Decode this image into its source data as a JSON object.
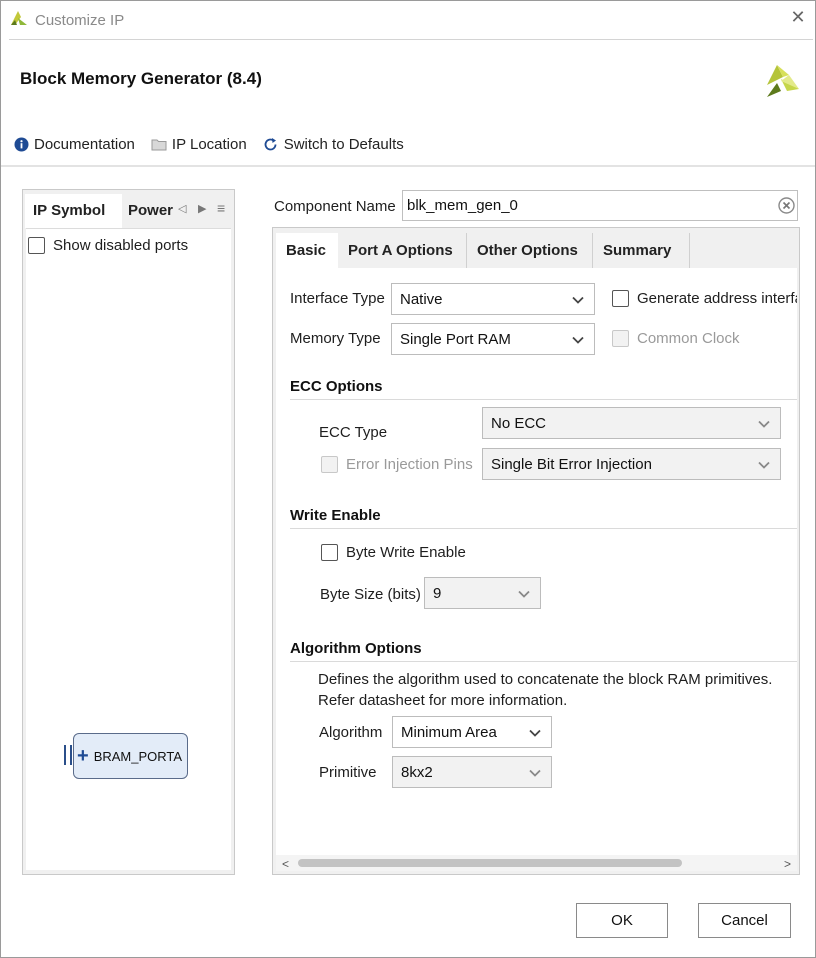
{
  "window": {
    "title": "Customize IP"
  },
  "header": {
    "title": "Block Memory Generator (8.4)"
  },
  "toolbar": {
    "documentation": "Documentation",
    "ip_location": "IP Location",
    "switch_defaults": "Switch to Defaults"
  },
  "left_panel": {
    "tabs": [
      "IP Symbol",
      "Power"
    ],
    "show_disabled_ports": "Show disabled ports",
    "symbol_port": "BRAM_PORTA"
  },
  "component": {
    "label": "Component Name",
    "value": "blk_mem_gen_0"
  },
  "tabs": [
    "Basic",
    "Port A Options",
    "Other Options",
    "Summary"
  ],
  "basic": {
    "interface_type_label": "Interface Type",
    "interface_type_value": "Native",
    "generate_address": "Generate address interfa",
    "memory_type_label": "Memory Type",
    "memory_type_value": "Single Port RAM",
    "common_clock": "Common Clock",
    "ecc": {
      "title": "ECC Options",
      "type_label": "ECC Type",
      "type_value": "No ECC",
      "error_pins": "Error Injection Pins",
      "error_value": "Single Bit Error Injection"
    },
    "write_enable": {
      "title": "Write Enable",
      "byte_write": "Byte Write Enable",
      "byte_size_label": "Byte Size (bits)",
      "byte_size_value": "9"
    },
    "algorithm": {
      "title": "Algorithm Options",
      "desc1": "Defines the algorithm used to concatenate the block RAM primitives.",
      "desc2": "Refer datasheet for more information.",
      "algo_label": "Algorithm",
      "algo_value": "Minimum Area",
      "prim_label": "Primitive",
      "prim_value": "8kx2"
    }
  },
  "footer": {
    "ok": "OK",
    "cancel": "Cancel"
  },
  "colors": {
    "logo_green": "#8fb83a",
    "info_blue": "#1f4b94"
  }
}
